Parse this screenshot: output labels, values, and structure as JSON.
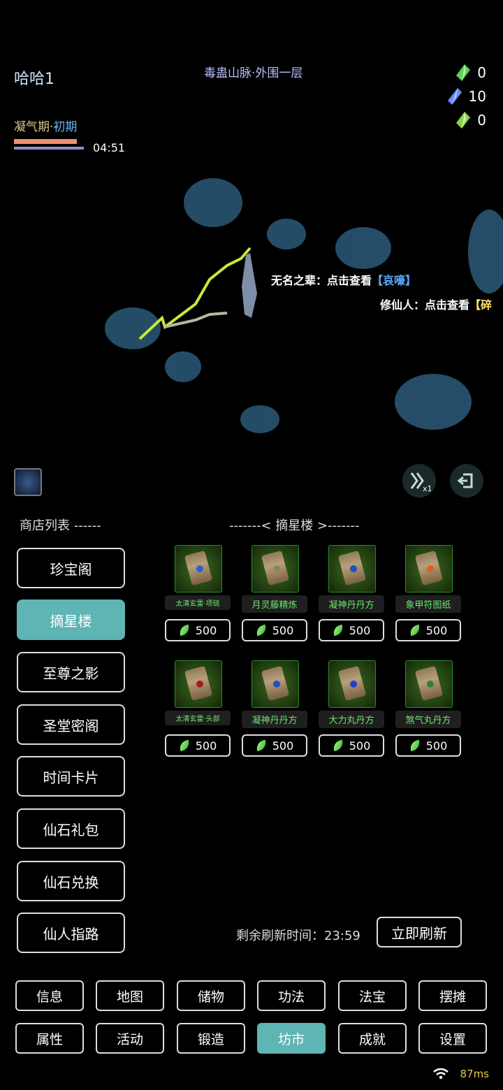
{
  "header": {
    "player_name": "哈哈1",
    "map_name": "毒蛊山脉·外围一层",
    "realm_main": "凝气期",
    "realm_sep": "·",
    "realm_stage": "初期",
    "timer": "04:51"
  },
  "currencies": [
    {
      "icon": "green-gem-icon",
      "value": "0",
      "color": "#5fd05f"
    },
    {
      "icon": "blue-gem-icon",
      "value": "10",
      "color": "#6a8cff"
    },
    {
      "icon": "green-gem-icon",
      "value": "0",
      "color": "#8bd04a"
    }
  ],
  "chat": [
    {
      "name": "无名之辈：",
      "action": "点击查看",
      "tag": "【哀嚎】"
    },
    {
      "name": "修仙人：",
      "action": "点击查看",
      "tag": "【碎"
    }
  ],
  "shop": {
    "list_title": "商店列表 ------",
    "header": "-------< 摘星楼 >-------",
    "buttons": [
      "珍宝阁",
      "摘星楼",
      "至尊之影",
      "圣堂密阁",
      "时间卡片",
      "仙石礼包",
      "仙石兑换",
      "仙人指路"
    ],
    "active_index": 1,
    "items": [
      {
        "name": "太清玄雷·项链",
        "price": "500",
        "gem_color": "#3060d0",
        "small": true
      },
      {
        "name": "月灵藤精炼",
        "price": "500",
        "gem_color": "#888866",
        "small": false
      },
      {
        "name": "凝神丹丹方",
        "price": "500",
        "gem_color": "#2050c0",
        "small": false
      },
      {
        "name": "象甲符图纸",
        "price": "500",
        "gem_color": "#e06020",
        "small": false
      },
      {
        "name": "太清玄雷·头部",
        "price": "500",
        "gem_color": "#a02020",
        "small": true
      },
      {
        "name": "凝神丹丹方",
        "price": "500",
        "gem_color": "#2050c0",
        "small": false
      },
      {
        "name": "大力丸丹方",
        "price": "500",
        "gem_color": "#2040d0",
        "small": false
      },
      {
        "name": "煞气丸丹方",
        "price": "500",
        "gem_color": "#308040",
        "small": false
      }
    ],
    "refresh_label": "剩余刷新时间：",
    "refresh_time": "23:59",
    "refresh_button": "立即刷新"
  },
  "nav": {
    "row1": [
      "信息",
      "地图",
      "储物",
      "功法",
      "法宝",
      "摆摊"
    ],
    "row2": [
      "属性",
      "活动",
      "锻造",
      "坊市",
      "成就",
      "设置"
    ],
    "active": "坊市"
  },
  "status": {
    "ping": "87ms"
  },
  "colors": {
    "accent": "#5fb4b4",
    "price_green": "#6fe46f"
  }
}
